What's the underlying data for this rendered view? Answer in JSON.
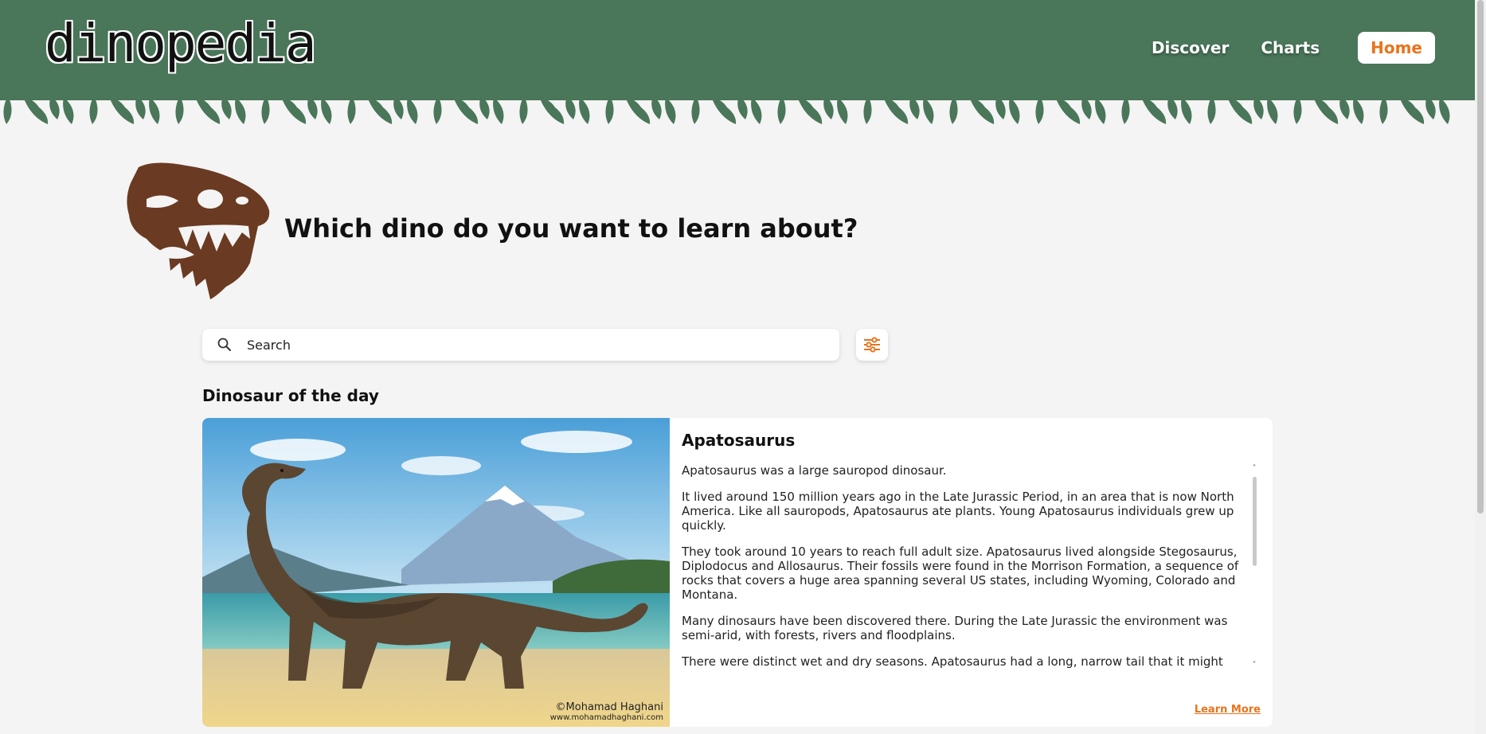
{
  "header": {
    "logo_text": "dinopedia",
    "nav": [
      {
        "label": "Discover"
      },
      {
        "label": "Charts"
      },
      {
        "label": "Home"
      }
    ]
  },
  "hero": {
    "title": "Which dino do you want to learn about?"
  },
  "search": {
    "placeholder": "Search"
  },
  "section": {
    "title": "Dinosaur of the day"
  },
  "dino_of_day": {
    "name": "Apatosaurus",
    "credit_name": "©Mohamad Haghani",
    "credit_url": "www.mohamadhaghani.com",
    "paragraphs": [
      "Apatosaurus was a large sauropod dinosaur.",
      "It lived around 150 million years ago in the Late Jurassic Period, in an area that is now North America. Like all sauropods, Apatosaurus ate plants. Young Apatosaurus individuals grew up quickly.",
      "They took around 10 years to reach full adult size. Apatosaurus lived alongside Stegosaurus, Diplodocus and Allosaurus. Their fossils were found in the Morrison Formation, a sequence of rocks that covers a huge area spanning several US states, including Wyoming, Colorado and Montana.",
      "Many dinosaurs have been discovered there. During the Late Jurassic the environment was semi-arid, with forests, rivers and floodplains.",
      "There were distinct wet and dry seasons. Apatosaurus had a long, narrow tail that it might"
    ],
    "learn_more": "Learn More"
  },
  "colors": {
    "header_green": "#4a7659",
    "accent_orange": "#e8741d",
    "skull_brown": "#6b3a22",
    "background": "#f4f4f4"
  }
}
